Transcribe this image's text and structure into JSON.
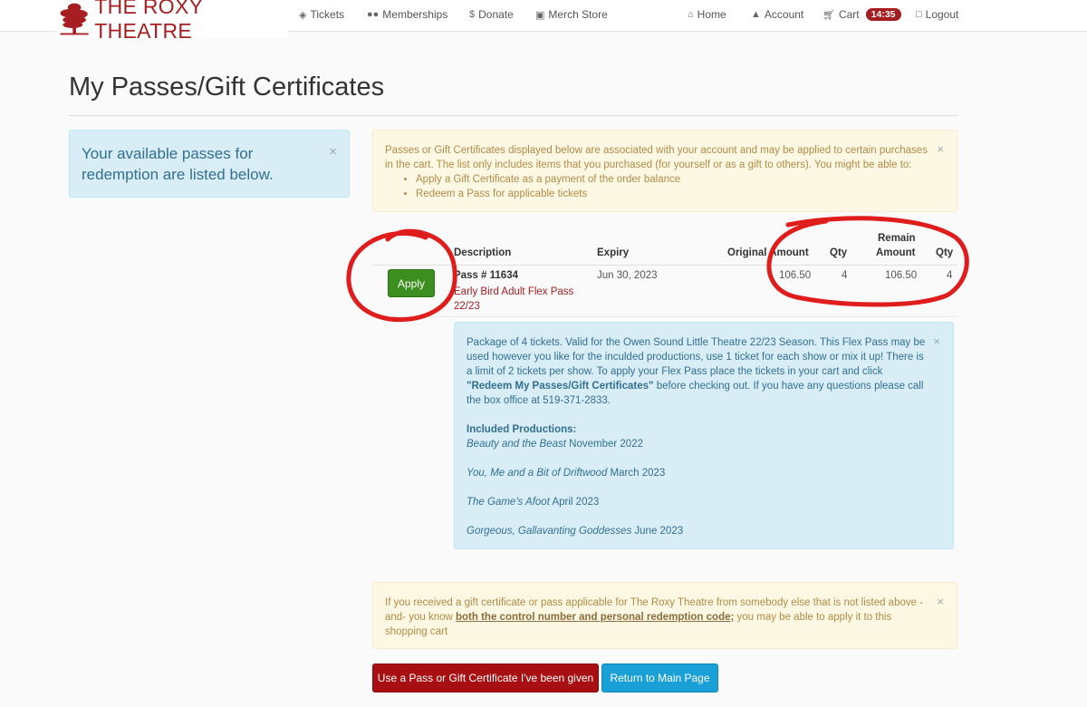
{
  "brand": {
    "name": "THE ROXY THEATRE",
    "color": "#a61e22"
  },
  "nav": {
    "tickets": "Tickets",
    "memberships": "Memberships",
    "donate": "Donate",
    "merch": "Merch Store",
    "home": "Home",
    "account": "Account",
    "cart": "Cart",
    "cart_timer": "14:35",
    "logout": "Logout"
  },
  "page": {
    "title": "My Passes/Gift Certificates"
  },
  "left_alert": {
    "text": "Your available passes for redemption are listed below.",
    "close": "×"
  },
  "notice": {
    "text": "Passes or Gift Certificates displayed below are associated with your account and may be applied to certain purchases in the cart. The list only includes items that you purchased (for yourself or as a gift to others). You might be able to:",
    "items": [
      "Apply a Gift Certificate as a payment of the order balance",
      "Redeem a Pass for applicable tickets"
    ],
    "close": "×"
  },
  "table": {
    "headers": {
      "description": "Description",
      "expiry": "Expiry",
      "original_amount": "Original Amount",
      "qty": "Qty",
      "remain_line1": "Remain",
      "remain_line2": "Amount",
      "remain_qty": "Qty"
    },
    "row": {
      "action": "Apply",
      "pass_number": "Pass # 11634",
      "pass_name": "Early Bird Adult Flex Pass 22/23",
      "expiry": "Jun 30, 2023",
      "original_amount": "106.50",
      "qty": "4",
      "remain_amount": "106.50",
      "remain_qty": "4"
    }
  },
  "description_box": {
    "text_before": "Package of 4 tickets. Valid for the Owen Sound Little Theatre 22/23 Season. This Flex Pass may be used however you like for the inculded productions, use 1 ticket for each show or mix it up! There is a limit of 2 tickets per show. To apply your Flex Pass place the tickets in your cart and click ",
    "bold_link": "\"Redeem My Passes/Gift Certificates\"",
    "text_after": " before checking out. If you have any questions please call the box office at 519-371-2833.",
    "included_heading": "Included Productions:",
    "productions": [
      {
        "title": "Beauty and the Beast",
        "date": "November 2022"
      },
      {
        "title": "You, Me and a Bit of Driftwood",
        "date": "March 2023"
      },
      {
        "title": "The Game's Afoot",
        "date": "April 2023"
      },
      {
        "title": "Gorgeous, Gallavanting Goddesses",
        "date": "June 2023"
      }
    ],
    "close": "×"
  },
  "gift_notice": {
    "text_before": "If you received a gift certificate or pass applicable for The Roxy Theatre from somebody else that is not listed above - and- you know ",
    "link": "both the control number and personal redemption code;",
    "text_after": " you may be able to apply it to this shopping cart",
    "close": "×"
  },
  "buttons": {
    "use_pass": "Use a Pass or Gift Certificate I've been given",
    "return": "Return to Main Page"
  }
}
